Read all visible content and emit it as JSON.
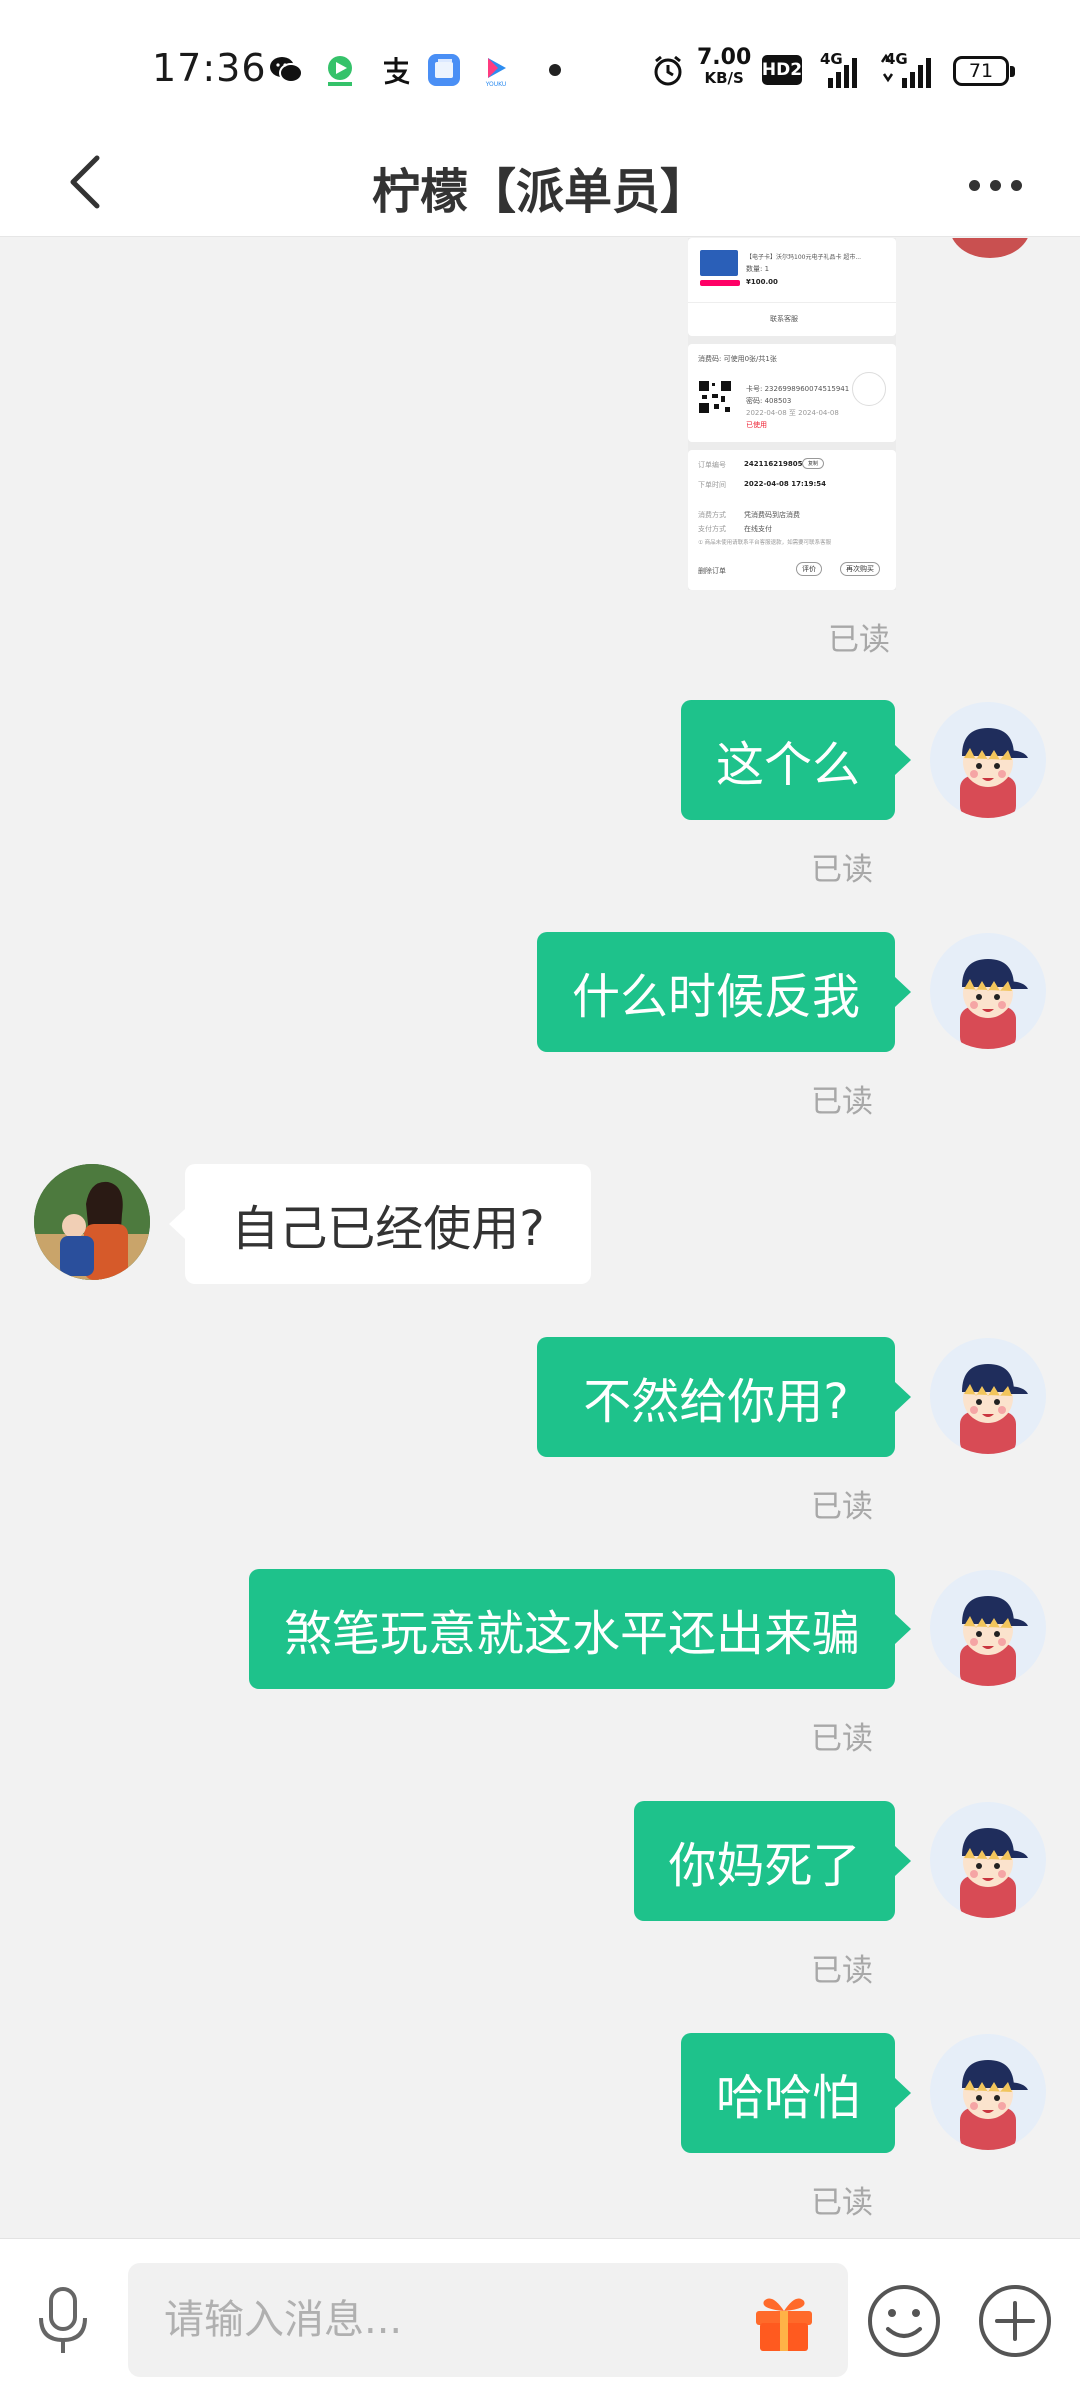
{
  "status_bar": {
    "time": "17:36",
    "net_speed_value": "7.00",
    "net_speed_unit": "KB/S",
    "hd_badge": "HD2",
    "sim1_label": "4G",
    "sim2_label": "4G",
    "battery_level": "71",
    "notification_icons": [
      "wechat-icon",
      "iqiyi-icon",
      "alipay-icon",
      "multitask-icon",
      "youku-icon"
    ]
  },
  "header": {
    "title": "柠檬【派单员】"
  },
  "messages": {
    "m1": {
      "text": "这个么",
      "receipt": "已读"
    },
    "m2": {
      "text": "什么时候反我",
      "receipt": "已读"
    },
    "m3": {
      "text": "自己已经使用?"
    },
    "m4": {
      "text": "不然给你用?",
      "receipt": "已读"
    },
    "m5": {
      "text": "煞笔玩意就这水平还出来骗",
      "receipt": "已读"
    },
    "m6": {
      "text": "你妈死了",
      "receipt": "已读"
    },
    "m7": {
      "text": "哈哈怕",
      "receipt": "已读"
    },
    "image_receipt": "已读"
  },
  "shared_image": {
    "product_line": "【电子卡】沃尔玛100元电子礼品卡 超市...",
    "quantity": "数量: 1",
    "price": "¥100.00",
    "contact_seller": "联系客服",
    "code_label": "消费码: 可使用0张/共1张",
    "card_no": "卡号: 2326998960074515941",
    "password": "密码: 408503",
    "validity": "2022-04-08 至 2024-04-08",
    "used_status": "已使用",
    "order_no_label": "订单编号",
    "order_no": "2421162198056",
    "copy": "复制",
    "order_time_label": "下单时间",
    "order_time": "2022-04-08 17:19:54",
    "consume_label": "消费方式",
    "consume_value": "凭消费码到店消费",
    "pay_label": "支付方式",
    "pay_value": "在线支付",
    "notice": "① 商品未使用请联系平台客服退款，如需要可联系客服",
    "delete_order": "删除订单",
    "review_btn": "评价",
    "buy_again_btn": "再次购买"
  },
  "input_bar": {
    "placeholder": "请输入消息..."
  },
  "colors": {
    "outgoing_bubble": "#1ec28b",
    "incoming_bubble": "#ffffff",
    "background": "#f2f2f2",
    "receipt_text": "#a8a8a8"
  }
}
